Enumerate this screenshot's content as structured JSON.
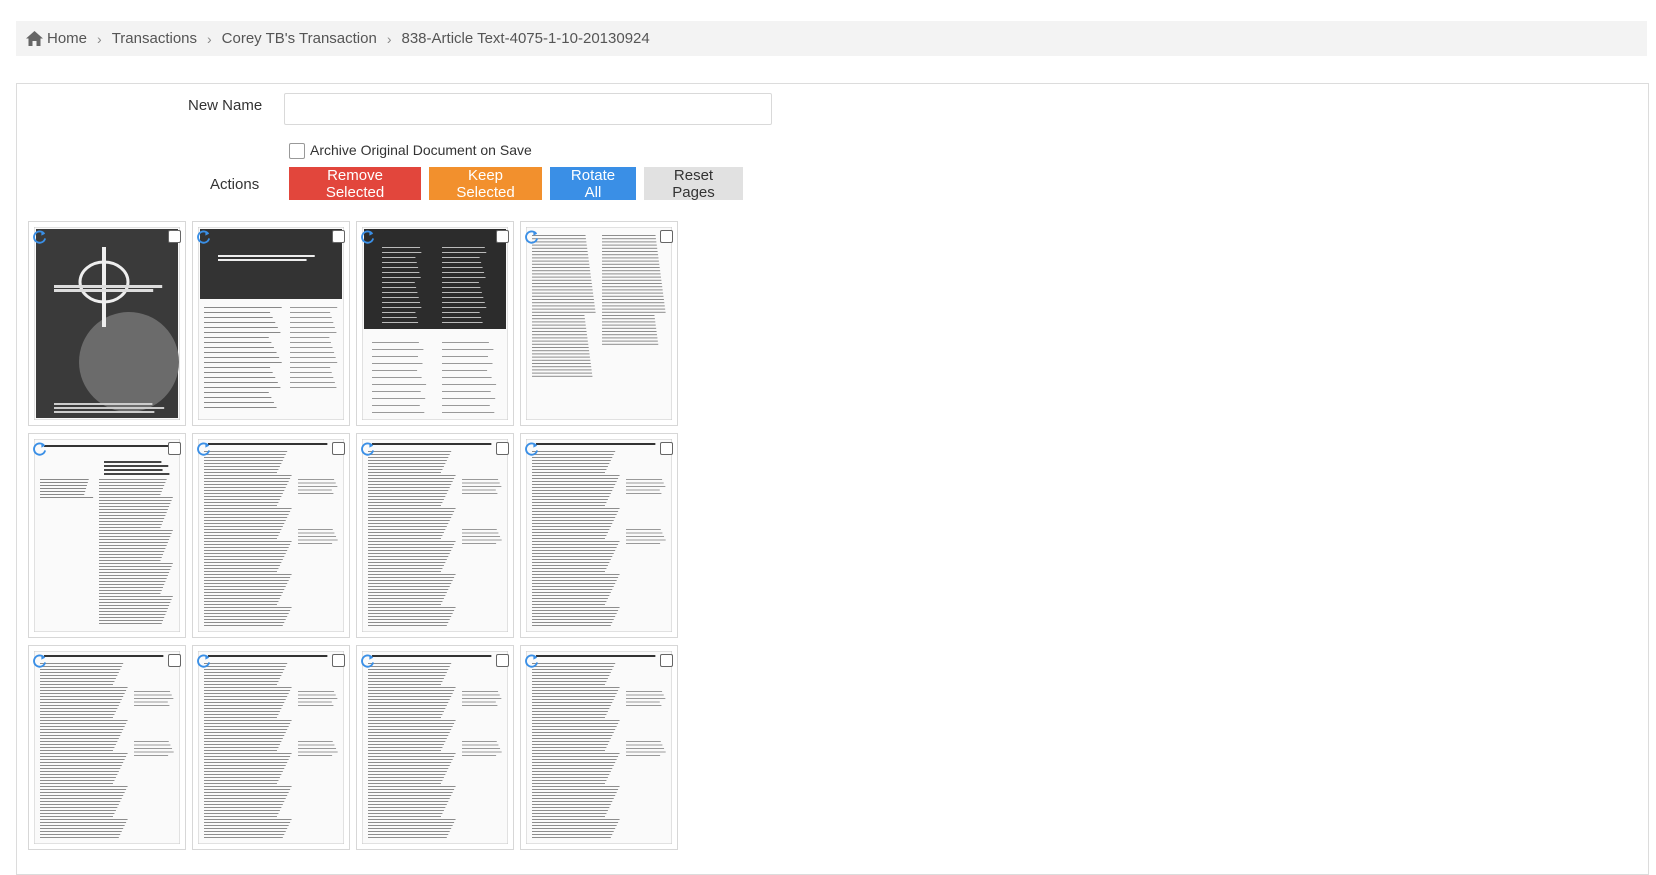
{
  "breadcrumb": {
    "items": [
      "Home",
      "Transactions",
      "Corey TB's Transaction",
      "838-Article Text-4075-1-10-20130924"
    ]
  },
  "form": {
    "new_name_label": "New Name",
    "new_name_value": "",
    "archive_label": "Archive Original Document on Save",
    "archive_checked": false,
    "actions_label": "Actions",
    "buttons": {
      "remove": "Remove Selected",
      "keep": "Keep Selected",
      "rotate": "Rotate All",
      "reset": "Reset Pages"
    }
  },
  "pages": [
    {
      "kind": "cover-dark"
    },
    {
      "kind": "cover-toc"
    },
    {
      "kind": "masthead"
    },
    {
      "kind": "text-2col"
    },
    {
      "kind": "article-start"
    },
    {
      "kind": "text-quote"
    },
    {
      "kind": "text-quote"
    },
    {
      "kind": "text-quote"
    },
    {
      "kind": "text-quote"
    },
    {
      "kind": "text-quote"
    },
    {
      "kind": "text-quote"
    },
    {
      "kind": "text-quote"
    }
  ],
  "colors": {
    "remove": "#e2463c",
    "keep": "#f2902d",
    "rotate": "#3a8fe6",
    "reset": "#e1e1e1",
    "rotate_icon": "#3a8fe6"
  },
  "icons": {
    "home": "home-icon",
    "separator": "chevron-right-icon",
    "rotate": "rotate-icon"
  }
}
